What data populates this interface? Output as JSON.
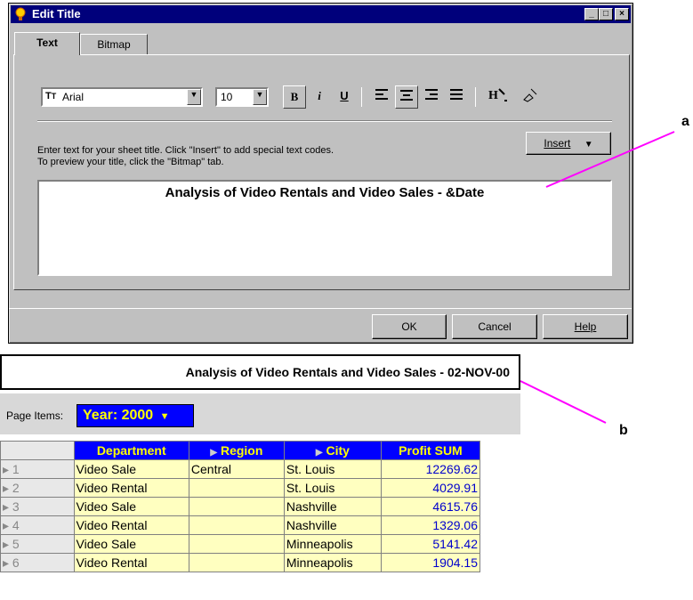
{
  "dialog": {
    "title": "Edit Title",
    "minimize": "_",
    "maximize": "□",
    "close": "×",
    "tabs": [
      "Text",
      "Bitmap"
    ],
    "font_name": "Arial",
    "font_size": "10",
    "toolbar": {
      "bold": "B",
      "italic": "i",
      "underline": "U"
    },
    "instructions_line1": "Enter text for your sheet title. Click \"Insert\" to add special text codes.",
    "instructions_line2": "To preview your title, click the \"Bitmap\" tab.",
    "insert_button": "Insert",
    "title_text": "Analysis of Video Rentals and Video Sales  - &Date",
    "ok_button": "OK",
    "cancel_button": "Cancel",
    "help_button": "Help"
  },
  "callouts": {
    "a": "a",
    "b": "b"
  },
  "sheet": {
    "title": "Analysis of Video Rentals and Video Sales  - 02-NOV-00",
    "page_items_label": "Page Items:",
    "page_item_value": "Year: 2000",
    "columns": [
      "Department",
      "Region",
      "City",
      "Profit SUM"
    ],
    "rows": [
      {
        "n": "1",
        "department": "Video Sale",
        "region": "Central",
        "city": "St. Louis",
        "profit": "12269.62"
      },
      {
        "n": "2",
        "department": "Video Rental",
        "region": "",
        "city": "St. Louis",
        "profit": "4029.91"
      },
      {
        "n": "3",
        "department": "Video Sale",
        "region": "",
        "city": "Nashville",
        "profit": "4615.76"
      },
      {
        "n": "4",
        "department": "Video Rental",
        "region": "",
        "city": "Nashville",
        "profit": "1329.06"
      },
      {
        "n": "5",
        "department": "Video Sale",
        "region": "",
        "city": "Minneapolis",
        "profit": "5141.42"
      },
      {
        "n": "6",
        "department": "Video Rental",
        "region": "",
        "city": "Minneapolis",
        "profit": "1904.15"
      }
    ]
  },
  "colors": {
    "title_bar": "#00007b",
    "header_bg": "#0000ff",
    "header_fg": "#ffff00",
    "cell_bg": "#ffffc0",
    "callout_line": "#ff00ff"
  }
}
